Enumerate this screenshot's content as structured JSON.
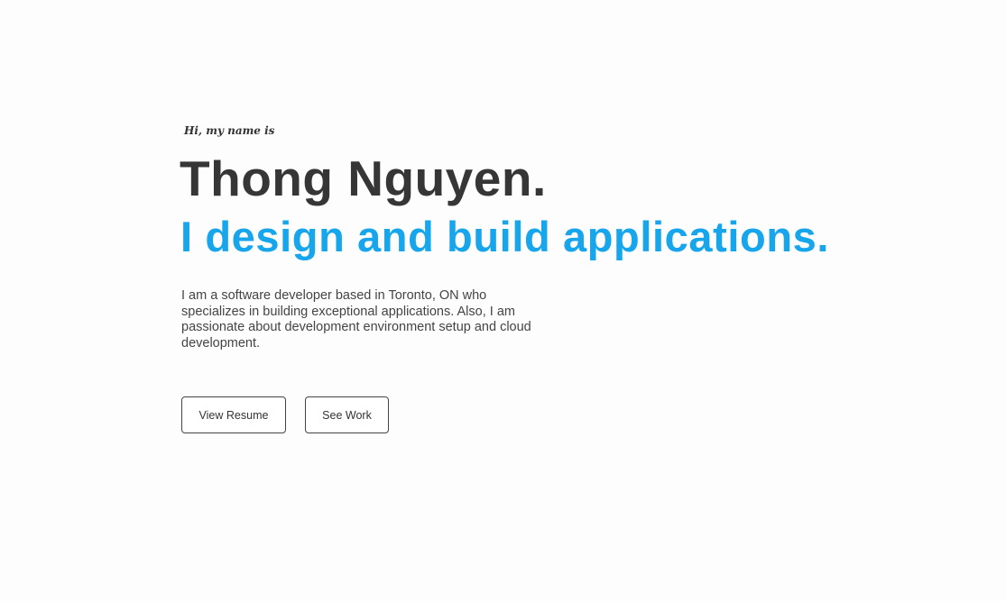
{
  "hero": {
    "greeting": "Hi, my name is",
    "name": "Thong Nguyen.",
    "tagline": "I design and build applications.",
    "description": "I am a software developer based in Toronto, ON who specializes in building exceptional applications. Also, I am passionate about development environment setup and cloud development.",
    "buttons": {
      "resume": "View Resume",
      "work": "See Work"
    }
  },
  "colors": {
    "accent": "#17a5ec",
    "text": "#363636",
    "background": "#fdfdfd"
  }
}
